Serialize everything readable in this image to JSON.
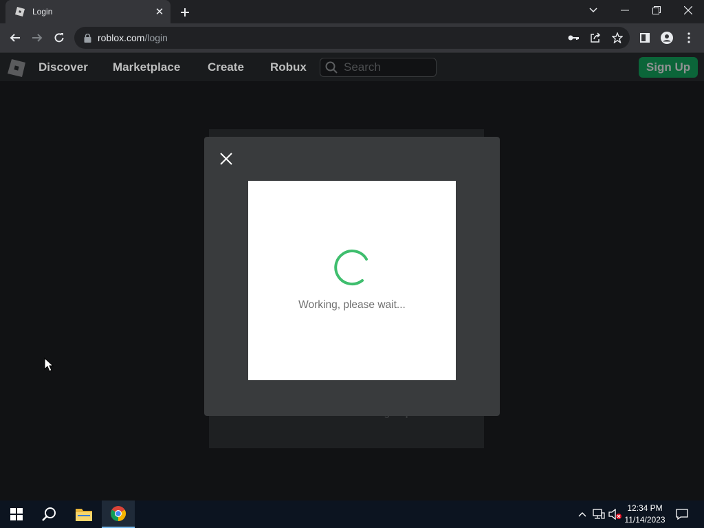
{
  "browser": {
    "tab_title": "Login",
    "tab_close_glyph": "✕",
    "url_host": "roblox.com",
    "url_path": "/login"
  },
  "nav": {
    "links": [
      "Discover",
      "Marketplace",
      "Create",
      "Robux"
    ],
    "search_placeholder": "Search",
    "signup_label": "Sign Up"
  },
  "login_card": {
    "obscured_text": "Don't have an account? Sign Up"
  },
  "modal": {
    "status_text": "Working, please wait...",
    "spinner_color": "#3fbe6e"
  },
  "taskbar": {
    "time": "12:34 PM",
    "date": "11/14/2023"
  },
  "colors": {
    "accent_green": "#00a250",
    "page_bg": "#111214",
    "modal_bg": "#393b3d"
  }
}
